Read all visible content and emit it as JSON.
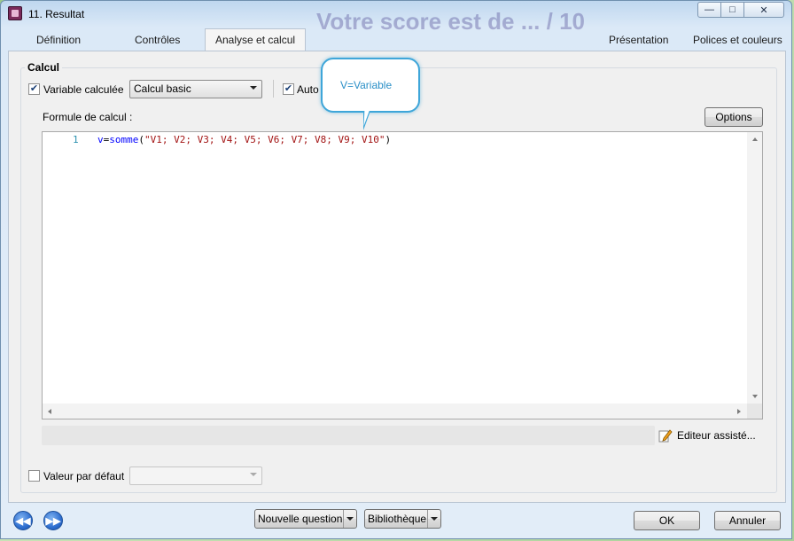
{
  "window": {
    "title": "11. Resultat",
    "background_text": "Votre score est de ... / 10",
    "controls": {
      "minimize": "—",
      "maximize": "□",
      "close": "✕"
    }
  },
  "tabs": [
    {
      "label": "Définition",
      "active": false
    },
    {
      "label": "Contrôles",
      "active": false
    },
    {
      "label": "Analyse et calcul",
      "active": true
    },
    {
      "label": "Présentation",
      "active": false
    },
    {
      "label": "Polices et couleurs",
      "active": false
    }
  ],
  "calcul": {
    "group_title": "Calcul",
    "variable_calculee": {
      "label": "Variable calculée",
      "checked": true
    },
    "calc_mode": {
      "selected": "Calcul basic"
    },
    "auto": {
      "label": "Auto",
      "checked": true
    },
    "formula_label": "Formule de calcul :",
    "options_button": "Options",
    "editor": {
      "line_number": "1",
      "tokens": {
        "var": "v",
        "eq": "=",
        "fn": "somme",
        "open": "(",
        "arg": "\"V1; V2; V3; V4; V5; V6; V7; V8; V9; V10\"",
        "close": ")"
      }
    },
    "assist_button": "Editeur assisté...",
    "valeur_defaut": {
      "label": "Valeur par défaut",
      "checked": false,
      "selected": ""
    }
  },
  "callout": {
    "text": "V=Variable"
  },
  "footer": {
    "prev": "◀◀",
    "next": "▶▶",
    "new_question": "Nouvelle question",
    "library": "Bibliothèque",
    "ok": "OK",
    "cancel": "Annuler"
  },
  "colors": {
    "accent": "#3fa6d9",
    "keyword": "#0000ff",
    "string": "#a31515",
    "line_number": "#2b91af"
  }
}
